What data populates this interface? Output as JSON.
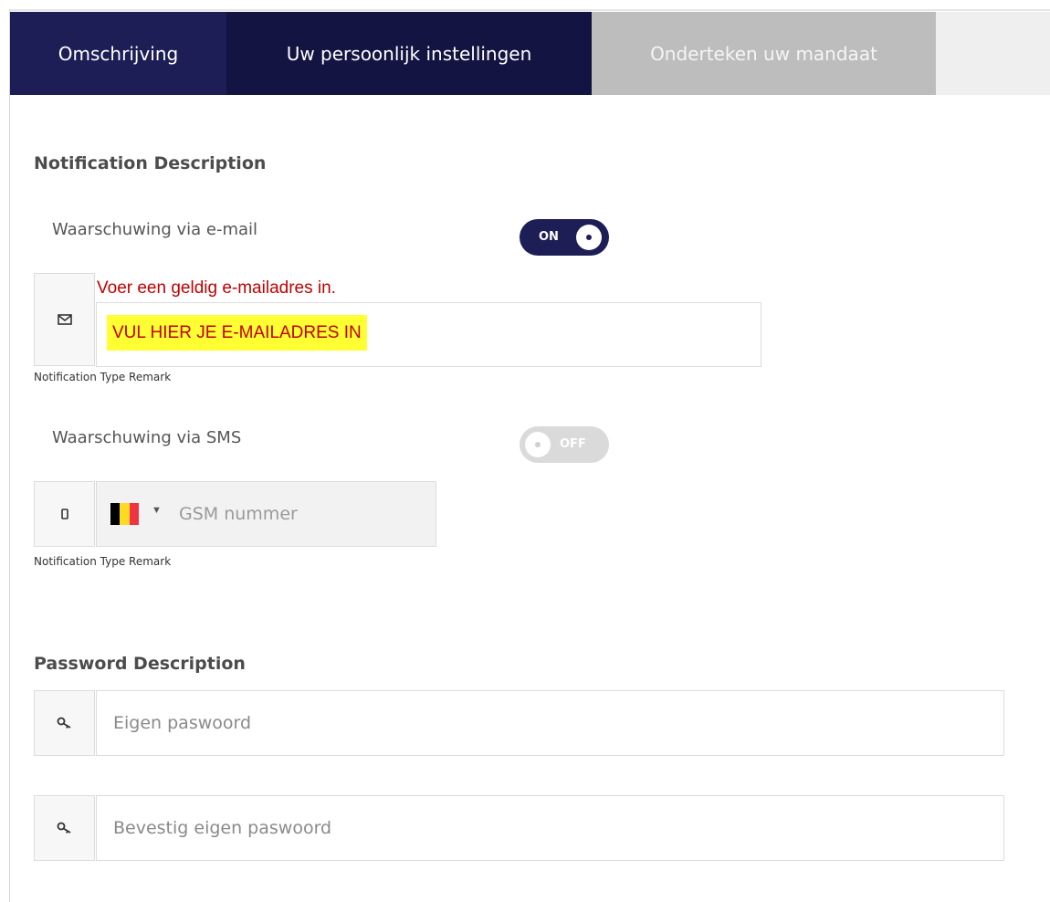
{
  "tabs": [
    {
      "label": "Omschrijving",
      "state": "completed"
    },
    {
      "label": "Uw persoonlijk instellingen",
      "state": "active"
    },
    {
      "label": "Onderteken uw mandaat",
      "state": "inactive"
    }
  ],
  "notification": {
    "title": "Notification Description",
    "email": {
      "label": "Waarschuwing via e-mail",
      "toggle": {
        "state": true,
        "text": "ON"
      },
      "icon": "envelope-icon",
      "error": "Voer een geldig e-mailadres in.",
      "value": "VUL HIER JE E-MAILADRES IN",
      "remark": "Notification Type Remark"
    },
    "sms": {
      "label": "Waarschuwing via SMS",
      "toggle": {
        "state": false,
        "text": "OFF"
      },
      "icon": "mobile-phone-icon",
      "country": "BE",
      "placeholder": "GSM nummer",
      "remark": "Notification Type Remark"
    }
  },
  "password": {
    "title": "Password Description",
    "fields": [
      {
        "icon": "key-icon",
        "placeholder": "Eigen paswoord"
      },
      {
        "icon": "key-icon",
        "placeholder": "Bevestig eigen paswoord"
      }
    ]
  },
  "colors": {
    "primary": "#1e1e57",
    "tab_active": "#141442",
    "tab_inactive": "#bdbdbd",
    "error": "#c00000",
    "highlight": "#ffff33",
    "belgium_flag": [
      "#000000",
      "#fdda24",
      "#ef3340"
    ]
  }
}
